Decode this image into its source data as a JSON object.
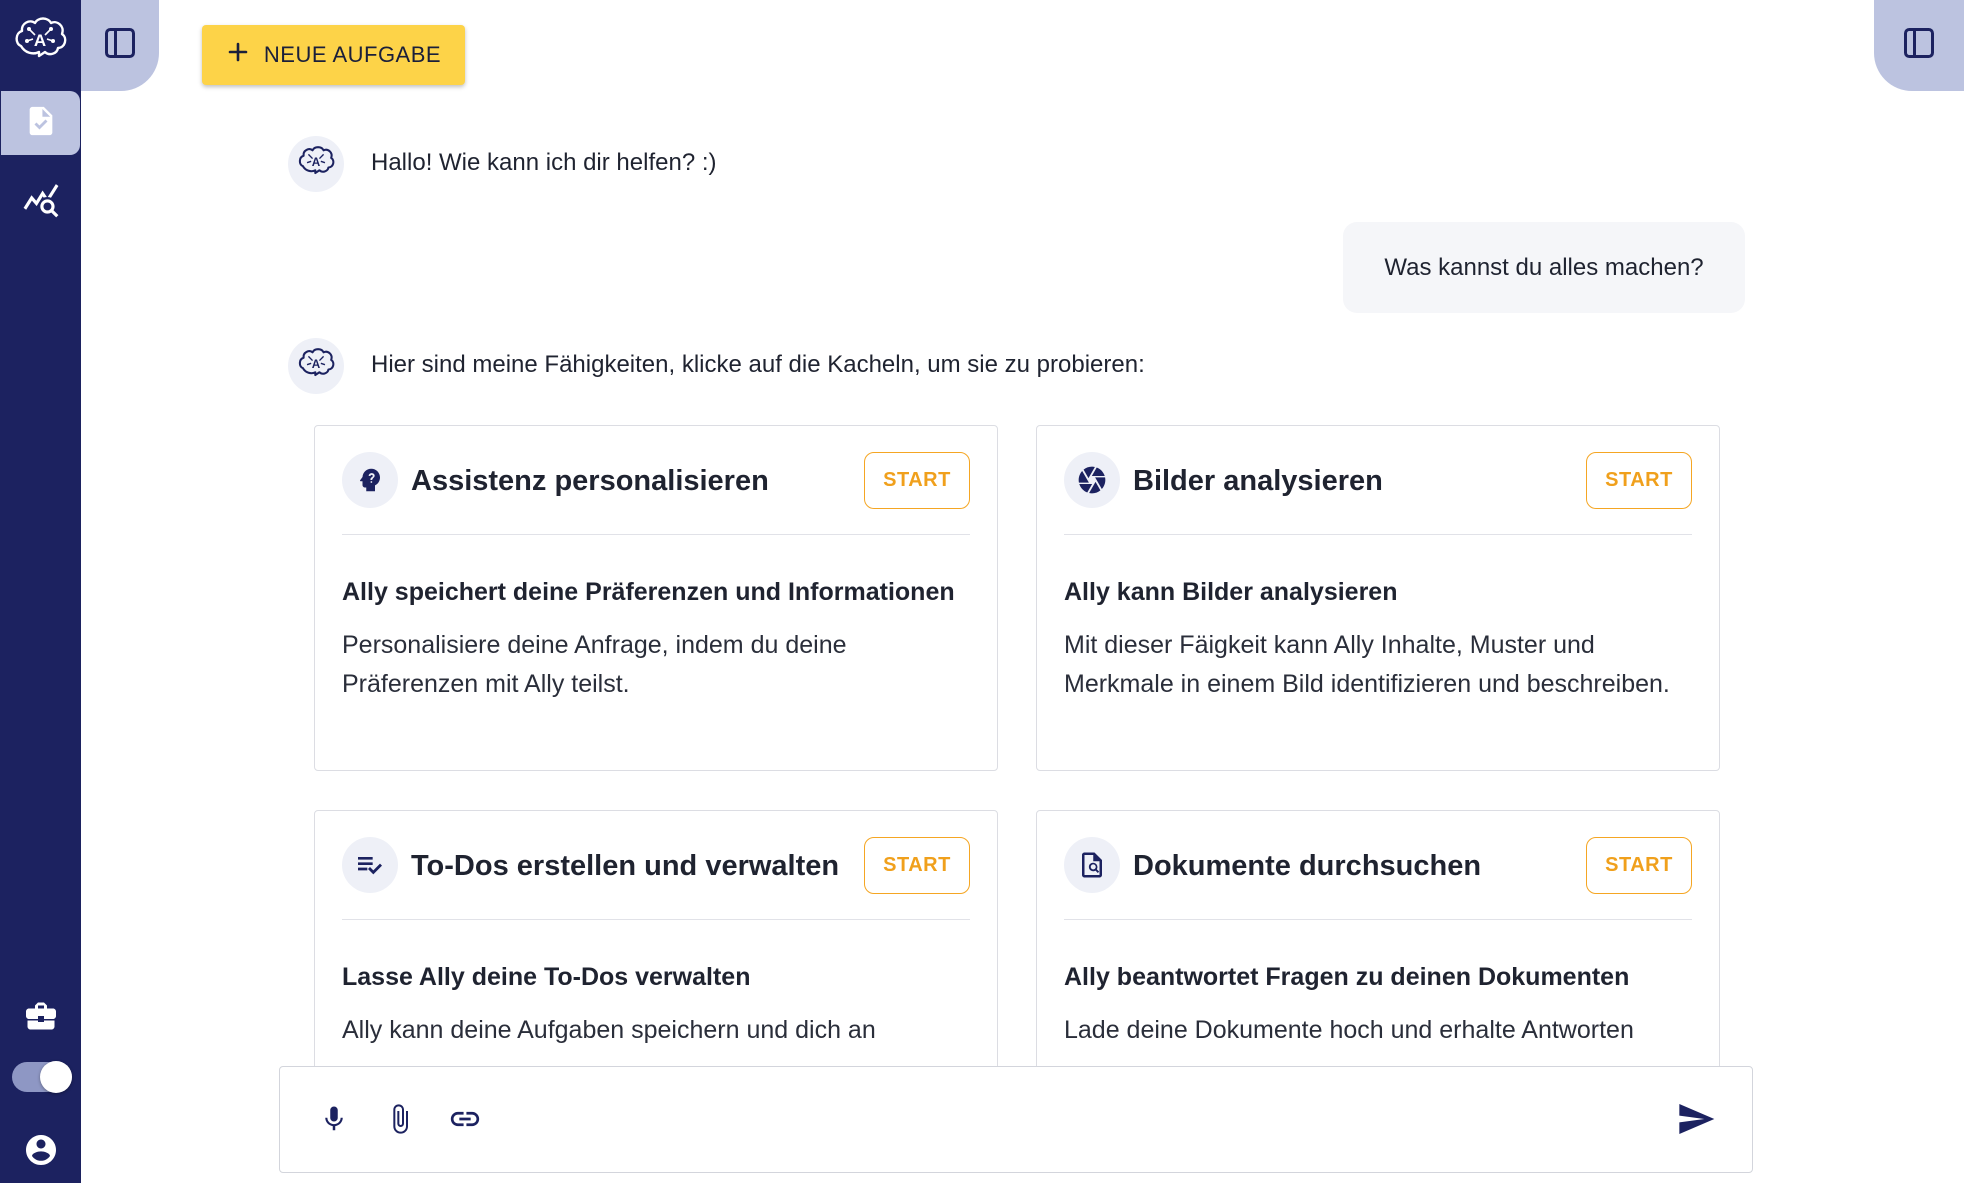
{
  "app": {
    "logo_letter": "A"
  },
  "toolbar": {
    "new_task_label": "NEUE AUFGABE"
  },
  "chat": {
    "greeting": "Hallo! Wie kann ich dir helfen? :)",
    "user_message": "Was kannst du alles machen?",
    "skills_intro": "Hier sind meine Fähigkeiten, klicke auf die Kacheln, um sie zu probieren:"
  },
  "skills": [
    {
      "title": "Assistenz personalisieren",
      "icon": "head-question-icon",
      "start_label": "START",
      "subtitle": "Ally speichert deine Präferenzen und Informationen",
      "description": "Personalisiere deine Anfrage, indem du deine Präferenzen mit Ally teilst."
    },
    {
      "title": "Bilder analysieren",
      "icon": "camera-shutter-icon",
      "start_label": "START",
      "subtitle": "Ally kann Bilder analysieren",
      "description": "Mit dieser Fäigkeit kann Ally Inhalte, Muster und Merkmale in einem Bild identifizieren und beschreiben."
    },
    {
      "title": "To-Dos erstellen und verwalten",
      "icon": "checklist-icon",
      "start_label": "START",
      "subtitle": "Lasse Ally deine To-Dos verwalten",
      "description": "Ally kann deine Aufgaben speichern und dich an"
    },
    {
      "title": "Dokumente durchsuchen",
      "icon": "document-search-icon",
      "start_label": "START",
      "subtitle": "Ally beantwortet Fragen zu deinen Dokumenten",
      "description": "Lade deine Dokumente hoch und erhalte Antworten"
    }
  ],
  "input": {
    "placeholder": ""
  },
  "colors": {
    "rail": "#1c2260",
    "accent_yellow": "#fdd348",
    "start_orange": "#f0a01c",
    "rail_active": "#bcc3e0"
  }
}
